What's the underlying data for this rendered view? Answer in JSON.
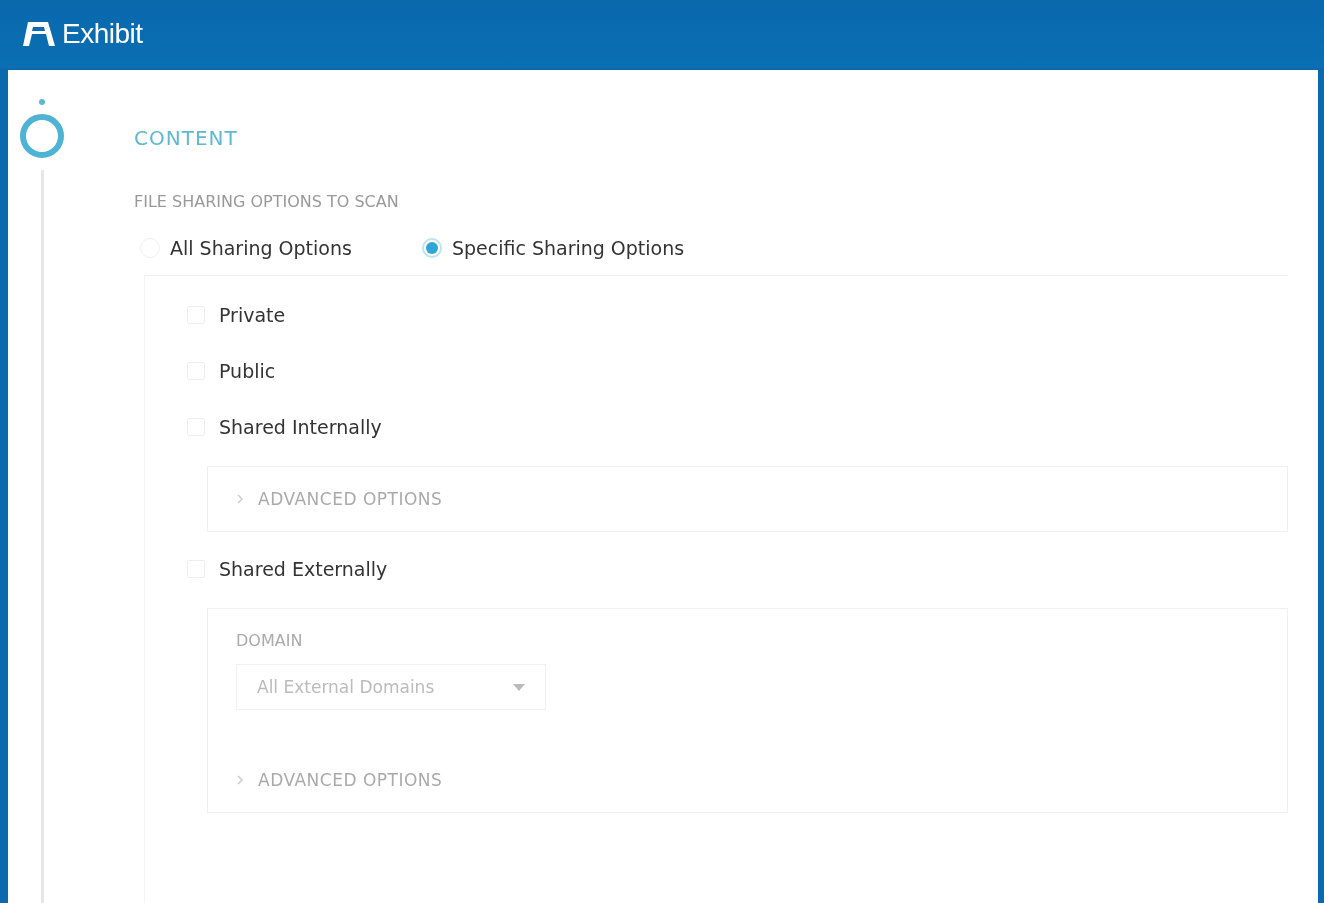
{
  "window": {
    "title": "Exhibit"
  },
  "step": {
    "title": "CONTENT"
  },
  "section_label": "FILE SHARING OPTIONS TO SCAN",
  "scope_options": [
    {
      "label": "All Sharing Options",
      "selected": false
    },
    {
      "label": "Specific Sharing Options",
      "selected": true
    }
  ],
  "sharing_types": [
    {
      "label": "Private",
      "checked": false
    },
    {
      "label": "Public",
      "checked": false
    },
    {
      "label": "Shared Internally",
      "checked": false,
      "advanced": {
        "label": "ADVANCED OPTIONS",
        "expanded": false
      }
    },
    {
      "label": "Shared Externally",
      "checked": false,
      "domain": {
        "label": "DOMAIN",
        "value": "All External Domains"
      },
      "advanced": {
        "label": "ADVANCED OPTIONS",
        "expanded": false
      }
    }
  ]
}
